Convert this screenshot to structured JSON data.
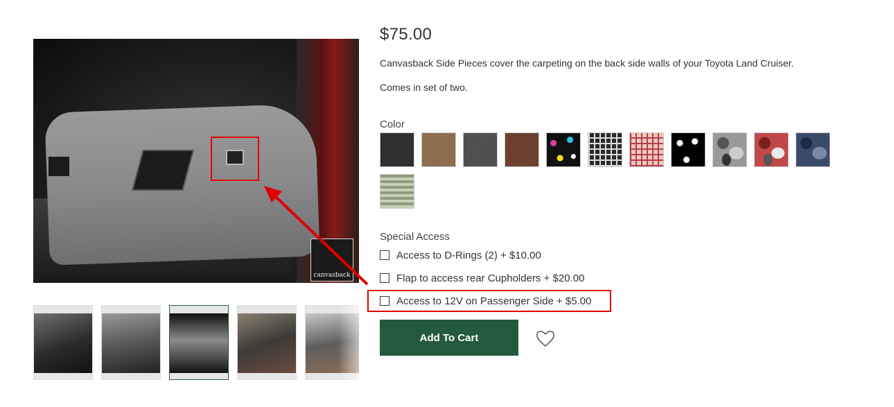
{
  "product": {
    "price": "$75.00",
    "description": "Canvasback Side Pieces cover the carpeting on the back side walls of your Toyota Land Cruiser.",
    "set_note": "Comes in set of two.",
    "image_logo_text": "canvasback"
  },
  "color": {
    "label": "Color",
    "swatches": [
      {
        "name": "black-swatch",
        "color": "#2a2a2a"
      },
      {
        "name": "tan-swatch",
        "color": "#8a6a4a"
      },
      {
        "name": "charcoal-swatch",
        "color": "#4a4a4a"
      },
      {
        "name": "brown-swatch",
        "color": "#6a3a2a"
      },
      {
        "name": "paint-splatter-swatch",
        "color": "#111111"
      },
      {
        "name": "black-plaid-swatch",
        "color": "#3a3a3a"
      },
      {
        "name": "pink-plaid-swatch",
        "color": "#e8b4a8"
      },
      {
        "name": "paw-print-swatch",
        "color": "#000000"
      },
      {
        "name": "gray-camo-swatch",
        "color": "#8a8a8a"
      },
      {
        "name": "red-camo-swatch",
        "color": "#b04040"
      },
      {
        "name": "blue-camo-swatch",
        "color": "#3a4a6a"
      },
      {
        "name": "digital-camo-swatch",
        "color": "#a8b09a"
      }
    ]
  },
  "special_access": {
    "label": "Special Access",
    "options": [
      {
        "label": "Access to D-Rings (2) + $10.00",
        "checked": false
      },
      {
        "label": "Flap to access rear Cupholders + $20.00",
        "checked": false
      },
      {
        "label": "Access to 12V on Passenger Side + $5.00",
        "checked": false
      }
    ]
  },
  "actions": {
    "add_to_cart": "Add To Cart"
  },
  "colors": {
    "accent": "#245a3b",
    "highlight": "#e00000"
  }
}
